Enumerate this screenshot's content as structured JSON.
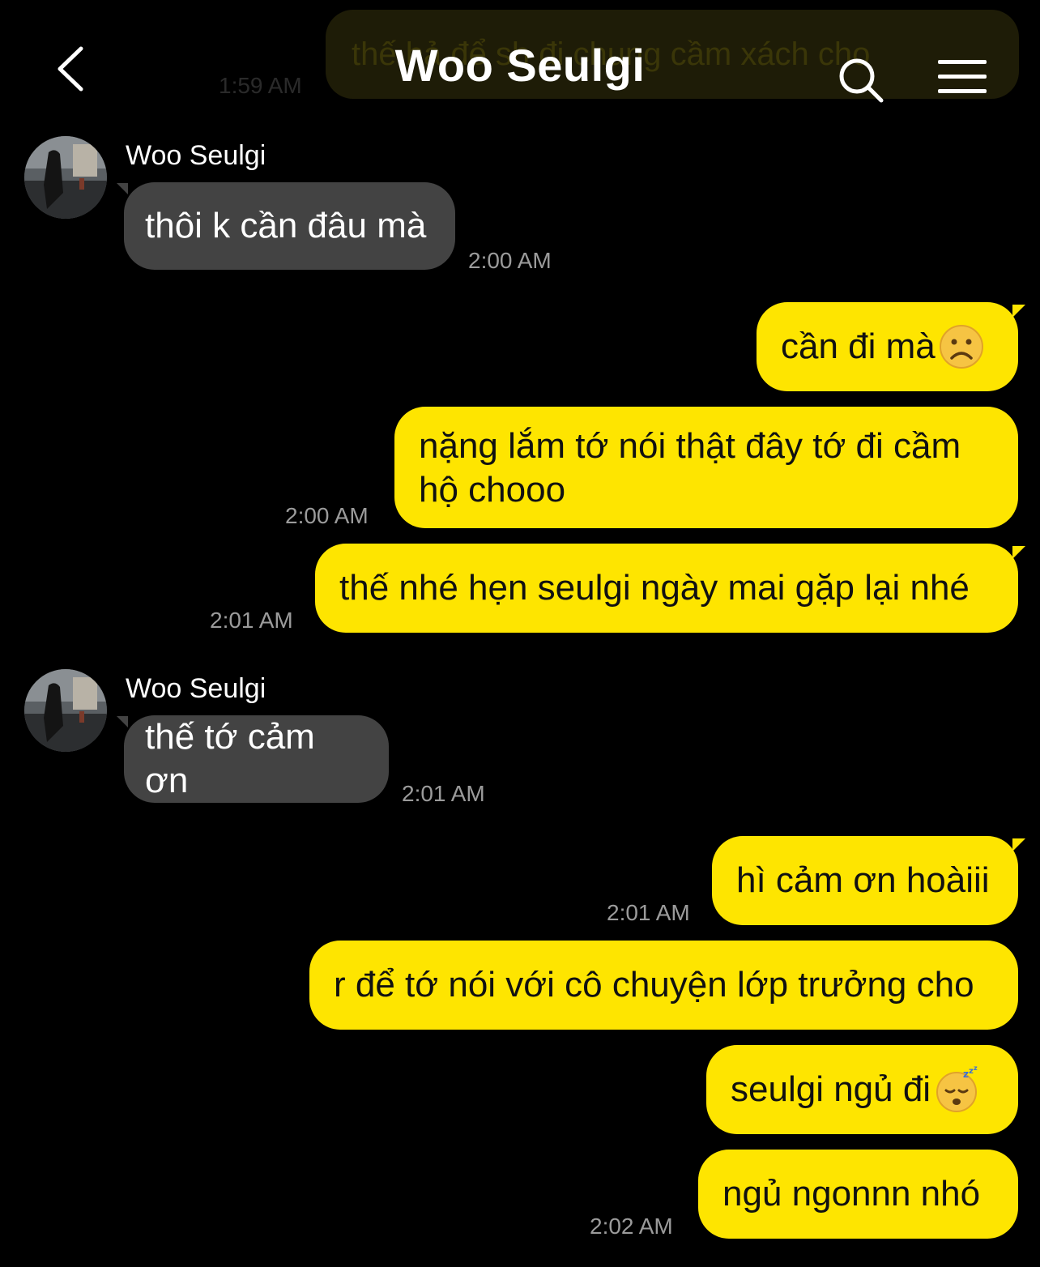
{
  "header": {
    "title": "Woo Seulgi"
  },
  "ghost_message": {
    "text": "thế hả để sh đi chung cầm xách cho",
    "time": "1:59 AM"
  },
  "messages": [
    {
      "sender": "Woo Seulgi",
      "text": "thôi k cần đâu mà",
      "time": "2:00 AM"
    },
    {
      "text": "cần đi mà",
      "emoji": "frowning-face-emoji"
    },
    {
      "text": "nặng lắm tớ nói thật đây tớ đi cầm hộ chooo",
      "time": "2:00 AM"
    },
    {
      "text": "thế nhé hẹn seulgi ngày mai gặp lại nhé",
      "time": "2:01 AM"
    },
    {
      "sender": "Woo Seulgi",
      "text": "thế tớ cảm ơn",
      "time": "2:01 AM"
    },
    {
      "text": "hì cảm ơn hoàiii",
      "time": "2:01 AM"
    },
    {
      "text": "r để tớ nói với cô chuyện lớp trưởng cho"
    },
    {
      "text": "seulgi ngủ đi",
      "emoji": "sleeping-face-emoji"
    },
    {
      "text": "ngủ ngonnn nhó",
      "time": "2:02 AM"
    }
  ],
  "colors": {
    "background": "#000000",
    "outgoing_bubble": "#fee500",
    "incoming_bubble": "#434343",
    "timestamp": "#9b9b9b"
  }
}
